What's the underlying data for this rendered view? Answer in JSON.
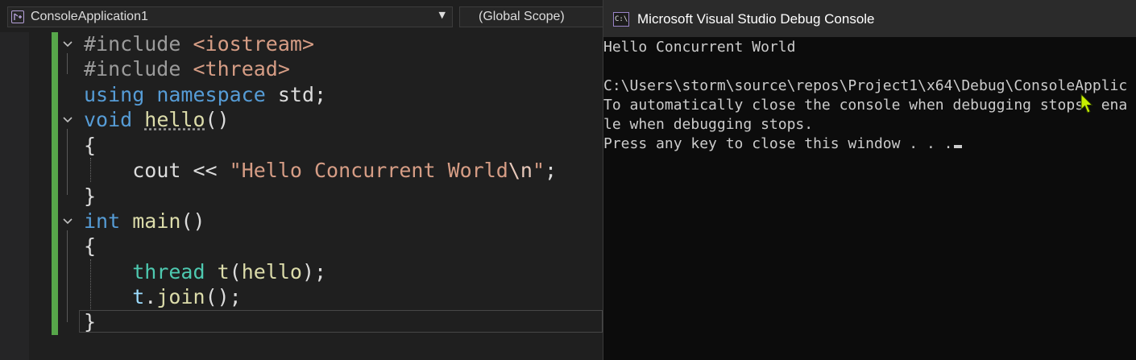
{
  "editor": {
    "project_dropdown": "ConsoleApplication1",
    "scope_dropdown": "(Global Scope)",
    "code": {
      "l1_kw": "#include",
      "l1_hdr": "<iostream>",
      "l2_kw": "#include",
      "l2_hdr": "<thread>",
      "l3_using": "using",
      "l3_ns": "namespace",
      "l3_std": "std;",
      "l4_void": "void",
      "l4_fn": "hello",
      "l4_parens": "()",
      "l5": "{",
      "l6_cout": "cout << ",
      "l6_str": "\"Hello Concurrent World",
      "l6_esc": "\\n",
      "l6_end": "\"",
      "l6_semi": ";",
      "l7": "}",
      "l8_int": "int",
      "l8_fn": "main",
      "l8_parens": "()",
      "l9": "{",
      "l10_type": "thread",
      "l10_var": "t",
      "l10_open": "(",
      "l10_arg": "hello",
      "l10_close": ");",
      "l11_var": "t",
      "l11_dot": ".",
      "l11_fn": "join",
      "l11_end": "();",
      "l12": "}"
    }
  },
  "console": {
    "title": "Microsoft Visual Studio Debug Console",
    "icon_text": "C:\\",
    "lines": [
      "Hello Concurrent World",
      "",
      "C:\\Users\\storm\\source\\repos\\Project1\\x64\\Debug\\ConsoleApplic",
      "To automatically close the console when debugging stops, ena",
      "le when debugging stops.",
      "Press any key to close this window . . ."
    ]
  },
  "colors": {
    "change_bar": "#57a64a",
    "keyword": "#569cd6",
    "string": "#d69d85",
    "function": "#dcdcaa",
    "type": "#4ec9b0",
    "console_bg": "#0c0c0c"
  },
  "icons": [
    "project-icon",
    "chevron-down-icon",
    "fold-collapse-icon",
    "console-app-icon",
    "mouse-cursor-icon"
  ]
}
